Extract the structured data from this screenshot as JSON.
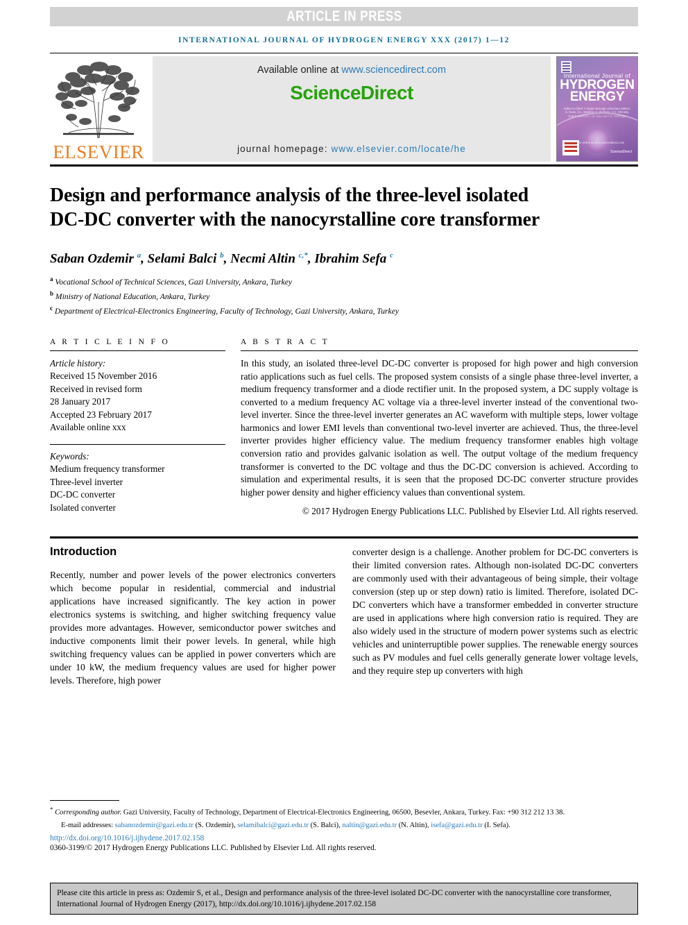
{
  "banner": {
    "text": "ARTICLE IN PRESS"
  },
  "running_head": "INTERNATIONAL JOURNAL OF HYDROGEN ENERGY XXX (2017) 1—12",
  "masthead": {
    "publisher": "ELSEVIER",
    "available_prefix": "Available online at ",
    "sciencedirect_url": "www.sciencedirect.com",
    "sciencedirect_logo": "ScienceDirect",
    "homepage_prefix": "journal homepage: ",
    "homepage_url": "www.elsevier.com/locate/he",
    "cover": {
      "line1": "International Journal of",
      "line2": "HYDROGEN",
      "line3": "ENERGY",
      "editors": "Editor-in-Chief: T. Nejat Veziroglu  Associate Editors: S. Dunn, D.L. Damkov, A. da Rosa, A.C. Ohmsky, D.M.F. Steffens, L.M. Das and T.N. Veziroglu",
      "tagline": "Available online at www.sciencedirect.com",
      "sd_mark": "ScienceDirect"
    }
  },
  "article": {
    "title": "Design and performance analysis of the three-level isolated DC-DC converter with the nanocyrstalline core transformer",
    "authors_html": "Saban Ozdemir <sup>a</sup>, Selami Balci <sup>b</sup>, Necmi Altin <sup>c,*</sup>, Ibrahim Sefa <sup>c</sup>",
    "affiliations": [
      {
        "mark": "a",
        "text": "Vocational School of Technical Sciences, Gazi University, Ankara, Turkey"
      },
      {
        "mark": "b",
        "text": "Ministry of National Education, Ankara, Turkey"
      },
      {
        "mark": "c",
        "text": "Department of Electrical-Electronics Engineering, Faculty of Technology, Gazi University, Ankara, Turkey"
      }
    ]
  },
  "article_info": {
    "heading": "A R T I C L E   I N F O",
    "history_label": "Article history:",
    "history": [
      "Received 15 November 2016",
      "Received in revised form",
      "28 January 2017",
      "Accepted 23 February 2017",
      "Available online xxx"
    ],
    "keywords_label": "Keywords:",
    "keywords": [
      "Medium frequency transformer",
      "Three-level inverter",
      "DC-DC converter",
      "Isolated converter"
    ]
  },
  "abstract": {
    "heading": "A B S T R A C T",
    "text": "In this study, an isolated three-level DC-DC converter is proposed for high power and high conversion ratio applications such as fuel cells. The proposed system consists of a single phase three-level inverter, a medium frequency transformer and a diode rectifier unit. In the proposed system, a DC supply voltage is converted to a medium frequency AC voltage via a three-level inverter instead of the conventional two-level inverter. Since the three-level inverter generates an AC waveform with multiple steps, lower voltage harmonics and lower EMI levels than conventional two-level inverter are achieved. Thus, the three-level inverter provides higher efficiency value. The medium frequency transformer enables high voltage conversion ratio and provides galvanic isolation as well. The output voltage of the medium frequency transformer is converted to the DC voltage and thus the DC-DC conversion is achieved. According to simulation and experimental results, it is seen that the proposed DC-DC converter structure provides higher power density and higher efficiency values than conventional system.",
    "copyright": "© 2017 Hydrogen Energy Publications LLC. Published by Elsevier Ltd. All rights reserved."
  },
  "body": {
    "section_heading": "Introduction",
    "left_column": "Recently, number and power levels of the power electronics converters which become popular in residential, commercial and industrial applications have increased significantly. The key action in power electronics systems is switching, and higher switching frequency value provides more advantages. However, semiconductor power switches and inductive components limit their power levels. In general, while high switching frequency values can be applied in power converters which are under 10 kW, the medium frequency values are used for higher power levels. Therefore, high power",
    "right_column": "converter design is a challenge. Another problem for DC-DC converters is their limited conversion rates. Although non-isolated DC-DC converters are commonly used with their advantageous of being simple, their voltage conversion (step up or step down) ratio is limited. Therefore, isolated DC-DC converters which have a transformer embedded in converter structure are used in applications where high conversion ratio is required. They are also widely used in the structure of modern power systems such as electric vehicles and uninterruptible power supplies. The renewable energy sources such as PV modules and fuel cells generally generate lower voltage levels, and they require step up converters with high"
  },
  "footnote": {
    "corresponding_star": "*",
    "corresponding_italic": "Corresponding author.",
    "corresponding_rest": " Gazi University, Faculty of Technology, Department of Electrical-Electronics Engineering, 06500, Besevler, Ankara, Turkey. Fax: +90 312 212 13 38.",
    "email_label": "E-mail addresses:",
    "emails": [
      {
        "address": "sabanozdemir@gazi.edu.tr",
        "person": "(S. Ozdemir)"
      },
      {
        "address": "selamibalci@gazi.edu.tr",
        "person": "(S. Balci)"
      },
      {
        "address": "naltin@gazi.edu.tr",
        "person": "(N. Altin)"
      },
      {
        "address": "isefa@gazi.edu.tr",
        "person": "(I. Sefa)"
      }
    ],
    "doi": "http://dx.doi.org/10.1016/j.ijhydene.2017.02.158",
    "issn_line": "0360-3199/© 2017 Hydrogen Energy Publications LLC. Published by Elsevier Ltd. All rights reserved."
  },
  "cite_box": {
    "text": "Please cite this article in press as: Ozdemir S, et al., Design and performance analysis of the three-level isolated DC-DC converter with the nanocyrstalline core transformer, International Journal of Hydrogen Energy (2017), http://dx.doi.org/10.1016/j.ijhydene.2017.02.158"
  },
  "colors": {
    "link": "#2b7bb9",
    "running_head": "#10709c",
    "sciencedirect_green": "#24a308",
    "elsevier_orange": "#ef7d22",
    "banner_bg": "#d2d2d2",
    "cite_box_bg": "#c8c8c8"
  }
}
